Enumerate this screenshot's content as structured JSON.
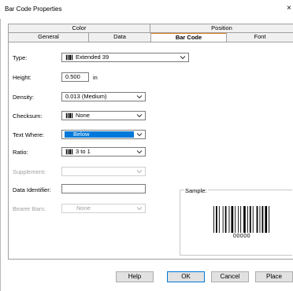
{
  "window": {
    "title": "Bar Code Properties",
    "close": "×"
  },
  "tabs_top": [
    {
      "label": "Color"
    },
    {
      "label": "Position"
    }
  ],
  "tabs_bottom": [
    {
      "label": "General"
    },
    {
      "label": "Data"
    },
    {
      "label": "Bar Code"
    },
    {
      "label": "Font"
    }
  ],
  "form": {
    "type": {
      "label": "Type:",
      "value": "Extended 39"
    },
    "height": {
      "label": "Height:",
      "value": "0.500",
      "unit": "in"
    },
    "density": {
      "label": "Density:",
      "value": "0.013 (Medium)"
    },
    "checksum": {
      "label": "Checksum:",
      "value": "None"
    },
    "text_where": {
      "label": "Text Where:",
      "value": "Below"
    },
    "ratio": {
      "label": "Ratio:",
      "value": "3 to 1"
    },
    "supplement": {
      "label": "Supplement:",
      "value": ""
    },
    "data_identifier": {
      "label": "Data Identifier:",
      "value": ""
    },
    "bearer_bars": {
      "label": "Bearer Bars:",
      "value": "None"
    }
  },
  "sample": {
    "label": "Sample:",
    "barcode_text": "00000"
  },
  "buttons": {
    "help": "Help",
    "ok": "OK",
    "cancel": "Cancel",
    "place": "Place"
  }
}
